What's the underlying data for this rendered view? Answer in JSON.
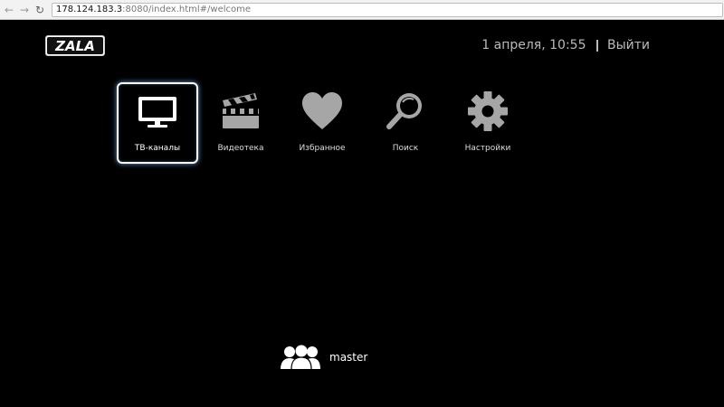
{
  "browser": {
    "back_icon": "back-arrow-icon",
    "forward_icon": "forward-arrow-icon",
    "reload_icon": "reload-icon",
    "url_host": "178.124.183.3",
    "url_rest": ":8080/index.html#/welcome"
  },
  "header": {
    "logo_text": "ZALA",
    "datetime": "1 апреля, 10:55",
    "logout_label": "Выйти"
  },
  "menu": {
    "items": [
      {
        "label": "ТВ-каналы",
        "icon": "tv-icon",
        "selected": true
      },
      {
        "label": "Видеотека",
        "icon": "clapperboard-icon",
        "selected": false
      },
      {
        "label": "Избранное",
        "icon": "heart-icon",
        "selected": false
      },
      {
        "label": "Поиск",
        "icon": "magnifier-icon",
        "selected": false
      },
      {
        "label": "Настройки",
        "icon": "gear-icon",
        "selected": false
      }
    ]
  },
  "user": {
    "icon": "users-icon",
    "name": "master"
  },
  "colors": {
    "background": "#000000",
    "icon_selected": "#ffffff",
    "icon_default": "#a6a6a6",
    "text_header": "#bbbbbb",
    "selection_glow": "#78b4ff"
  }
}
